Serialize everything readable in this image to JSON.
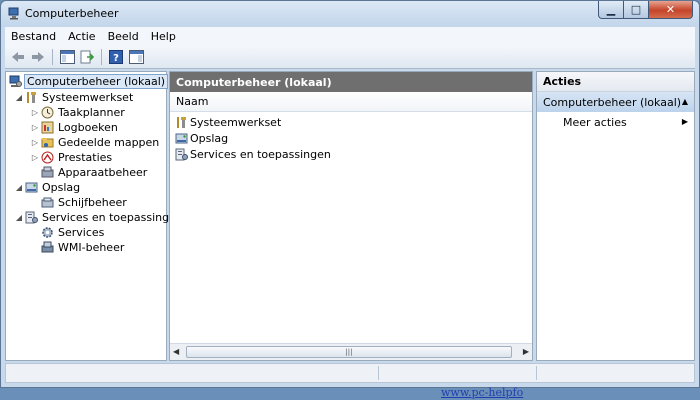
{
  "window": {
    "title": "Computerbeheer"
  },
  "menu": [
    "Bestand",
    "Actie",
    "Beeld",
    "Help"
  ],
  "tree": [
    {
      "label": "Computerbeheer (lokaal)",
      "level": 0,
      "expander": "",
      "icon": "computer-management-icon",
      "selected": true
    },
    {
      "label": "Systeemwerkset",
      "level": 1,
      "expander": "expanded",
      "icon": "system-tools-icon"
    },
    {
      "label": "Taakplanner",
      "level": 2,
      "expander": "collapsed",
      "icon": "task-scheduler-icon"
    },
    {
      "label": "Logboeken",
      "level": 2,
      "expander": "collapsed",
      "icon": "event-viewer-icon"
    },
    {
      "label": "Gedeelde mappen",
      "level": 2,
      "expander": "collapsed",
      "icon": "shared-folders-icon"
    },
    {
      "label": "Prestaties",
      "level": 2,
      "expander": "collapsed",
      "icon": "performance-icon"
    },
    {
      "label": "Apparaatbeheer",
      "level": 2,
      "expander": "",
      "icon": "device-manager-icon"
    },
    {
      "label": "Opslag",
      "level": 1,
      "expander": "expanded",
      "icon": "storage-icon"
    },
    {
      "label": "Schijfbeheer",
      "level": 2,
      "expander": "",
      "icon": "disk-management-icon"
    },
    {
      "label": "Services en toepassingen",
      "level": 1,
      "expander": "expanded",
      "icon": "services-applications-icon"
    },
    {
      "label": "Services",
      "level": 2,
      "expander": "",
      "icon": "services-icon"
    },
    {
      "label": "WMI-beheer",
      "level": 2,
      "expander": "",
      "icon": "wmi-control-icon"
    }
  ],
  "center": {
    "header": "Computerbeheer (lokaal)",
    "column": "Naam",
    "items": [
      {
        "label": "Systeemwerkset",
        "icon": "system-tools-icon"
      },
      {
        "label": "Opslag",
        "icon": "storage-icon"
      },
      {
        "label": "Services en toepassingen",
        "icon": "services-applications-icon"
      }
    ]
  },
  "actions": {
    "title": "Acties",
    "section": "Computerbeheer (lokaal)",
    "items": [
      "Meer acties"
    ]
  },
  "background": {
    "link": "www.pc-helpfo"
  }
}
